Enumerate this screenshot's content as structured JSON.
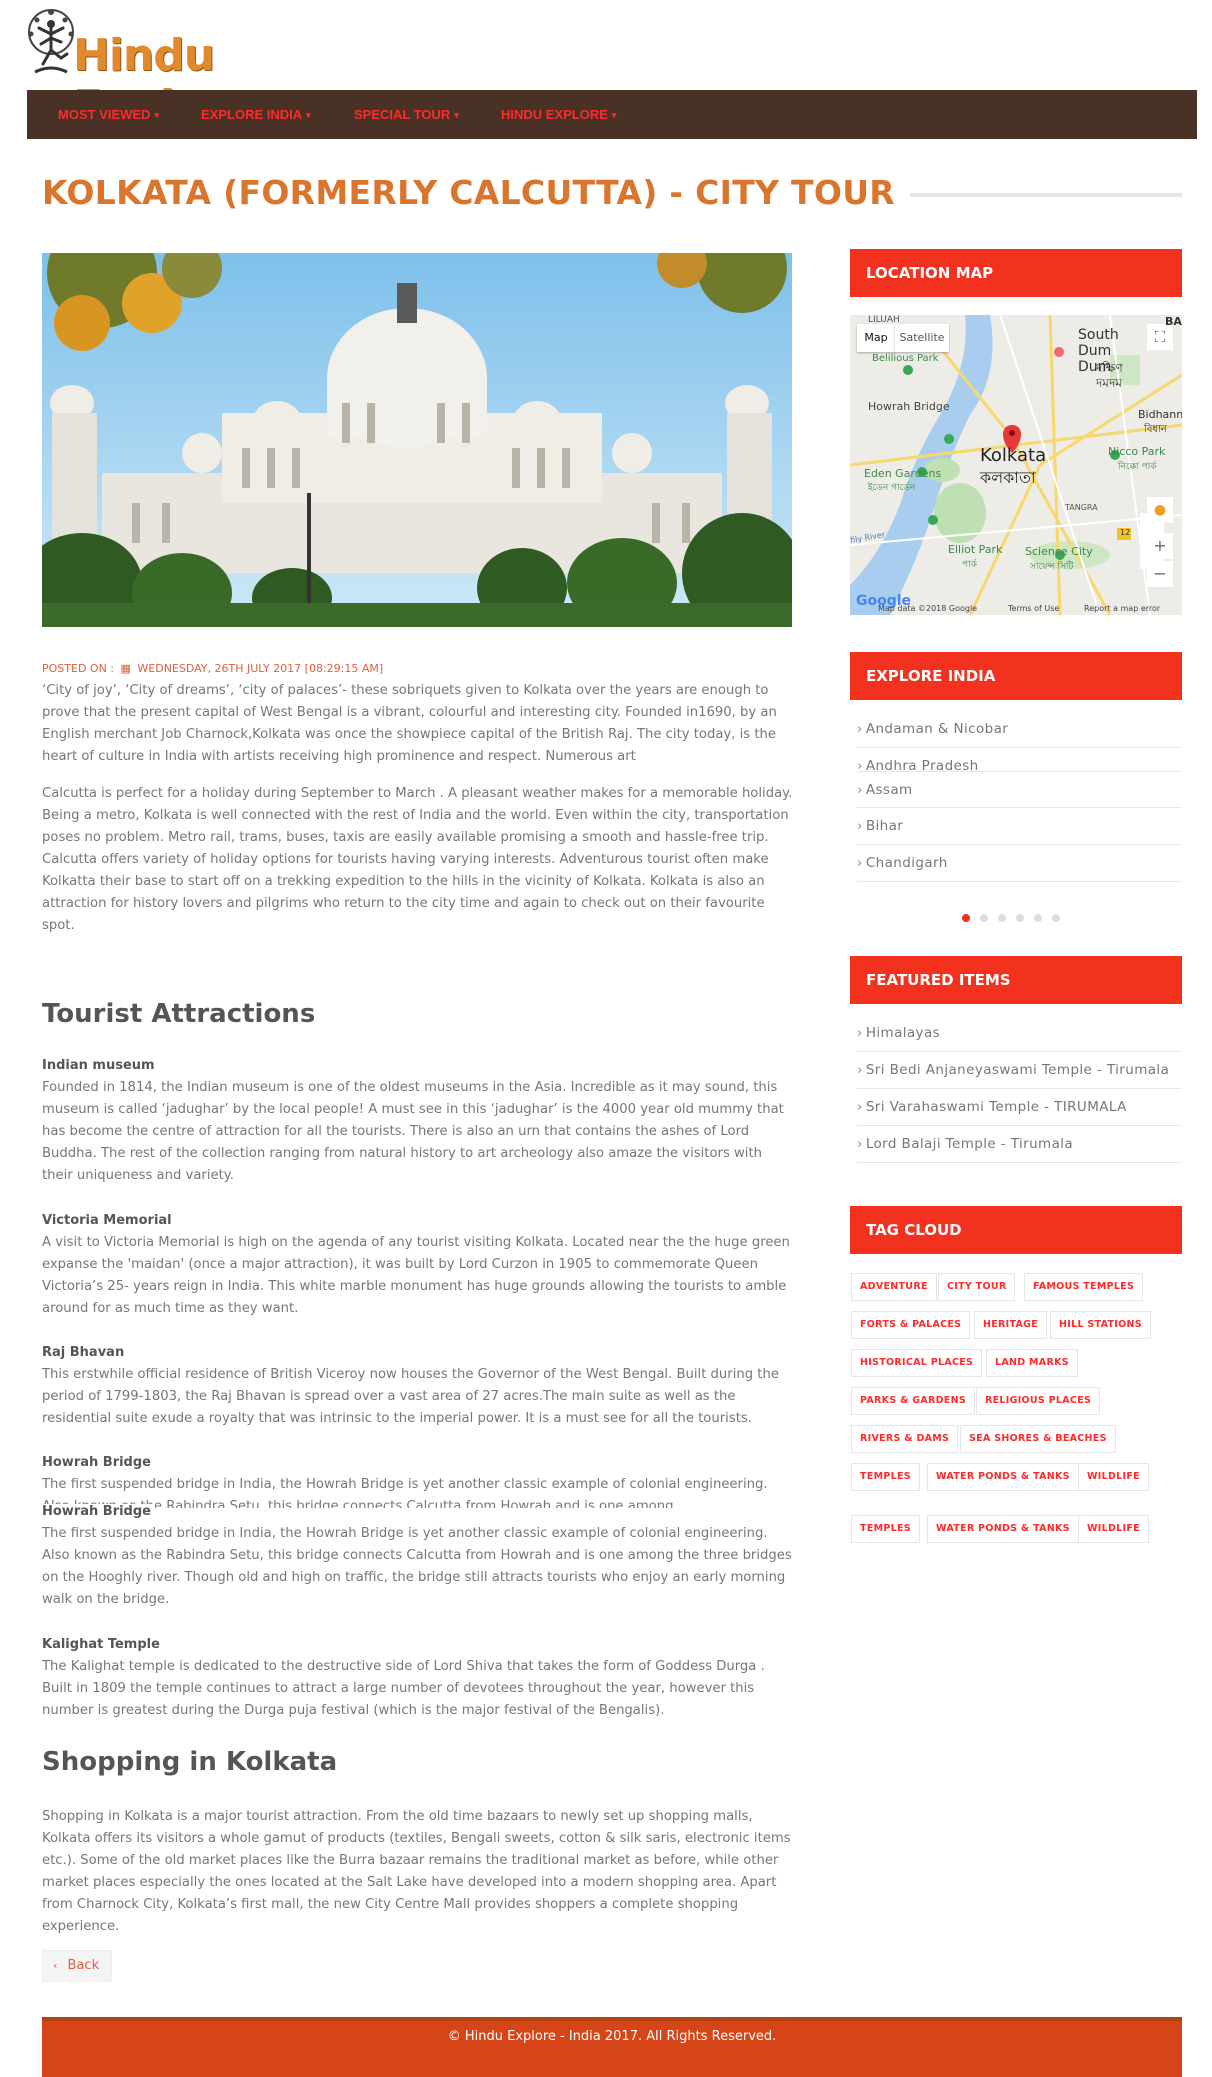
{
  "brand": {
    "name": "Hindu Explore"
  },
  "nav": {
    "items": [
      {
        "label": "MOST VIEWED"
      },
      {
        "label": "EXPLORE INDIA"
      },
      {
        "label": "SPECIAL TOUR"
      },
      {
        "label": "HINDU EXPLORE"
      }
    ]
  },
  "page": {
    "title": "KOLKATA (FORMERLY CALCUTTA) - CITY TOUR",
    "posted_on_label": "POSTED ON :",
    "posted_on_date": "WEDNESDAY, 26TH JULY 2017 [08:29:15 AM]",
    "intro_1": "‘City of joy’, ‘City of dreams’, ‘city of palaces’- these sobriquets given to Kolkata over the years are enough to prove that the present capital of West Bengal is a vibrant, colourful and interesting city. Founded in1690, by an English merchant Job Charnock,Kolkata was once the showpiece capital of the British Raj. The city today, is the heart of culture in India with artists receiving high prominence and respect. Numerous art",
    "intro_2": "Calcutta is perfect for a holiday during September to March . A pleasant weather makes for a memorable holiday. Being a metro, Kolkata is well connected with the rest of India and the world. Even within the city, transportation poses no problem. Metro rail, trams, buses, taxis are easily available promising a smooth and hassle-free trip. Calcutta offers variety of holiday options for tourists having varying interests. Adventurous tourist often make Kolkatta their base to start off on a trekking expedition to the hills in the vicinity of Kolkata. Kolkata is also an attraction for history lovers and pilgrims who return to the city time and again to check out on their favourite spot.",
    "attractions_heading": "Tourist Attractions",
    "attractions": [
      {
        "title": "Indian museum",
        "text": "Founded in 1814, the Indian museum is one of the oldest museums in the Asia. Incredible as it may sound, this museum is called ‘jadughar’ by the local people! A must see in this ‘jadughar’ is the 4000 year old mummy that has become the centre of attraction for all the tourists. There is also an urn that contains the ashes of Lord Buddha. The rest of the collection ranging from natural history to art archeology also amaze the visitors with their uniqueness and variety."
      },
      {
        "title": "Victoria Memorial",
        "text": "A visit to Victoria Memorial is high on the agenda of any tourist visiting Kolkata. Located near the the huge green expanse the 'maidan' (once a major attraction), it was built by Lord Curzon in 1905 to commemorate Queen Victoria’s 25- years reign in India. This white marble monument has huge grounds allowing the tourists to amble around for as much time as they want."
      },
      {
        "title": "Raj Bhavan",
        "text": "This erstwhile official residence of British Viceroy now houses the Governor of the West Bengal. Built during the period of 1799-1803, the Raj Bhavan is spread over a vast area of 27 acres.The main suite as well as the residential suite exude a royalty that was intrinsic to the imperial power. It is a must see for all the tourists."
      },
      {
        "title": "Howrah Bridge",
        "text": "The first suspended bridge in India, the Howrah Bridge is yet another classic example of colonial engineering. Also known as the Rabindra Setu, this bridge connects Calcutta from Howrah and is one among"
      },
      {
        "title": "Howrah Bridge",
        "text": "The first suspended bridge in India, the Howrah Bridge is yet another classic example of colonial engineering. Also known as the Rabindra Setu, this bridge connects Calcutta from Howrah and is one among the three bridges on the Hooghly river. Though old and high on traffic, the bridge still attracts tourists who enjoy an early morning walk on the bridge."
      },
      {
        "title": "Kalighat Temple",
        "text": "The Kalighat temple is dedicated to the destructive side of Lord Shiva that takes the form of Goddess Durga . Built in 1809 the temple continues to attract a large number of devotees throughout the year, however this number is greatest during the Durga puja festival (which is the major festival of the Bengalis)."
      }
    ],
    "shopping_heading": "Shopping in Kolkata",
    "shopping_text": "Shopping in Kolkata is a major tourist attraction. From the old time bazaars to newly set up shopping malls, Kolkata offers its visitors a whole gamut of products (textiles, Bengali sweets, cotton & silk saris, electronic items etc.). Some of the old market places like the Burra bazaar remains the traditional market as before, while other market places especially the ones located at the Salt Lake have developed into a modern shopping area. Apart from Charnock City, Kolkata’s first mall, the new City Centre Mall provides shoppers a complete shopping experience.",
    "back_label": "Back"
  },
  "sidebar": {
    "location_map": {
      "heading": "LOCATION MAP",
      "map_type_map": "Map",
      "map_type_satellite": "Satellite",
      "labels": {
        "kolkata": "Kolkata",
        "kolkata_bn": "কলকাতা",
        "howrah_bridge": "Howrah Bridge",
        "eden_gardens": "Eden Gardens",
        "eden_gardens_bn": "ইডেন গার্ডেন",
        "elliot_park": "Elliot Park",
        "elliot_park_bn": "পার্ক",
        "science_city": "Science City",
        "science_city_bn": "সায়েন্স সিটি",
        "nicco_park": "Nicco Park",
        "nicco_park_bn": "নিক্কো পার্ক",
        "south_dum_dum": "South Dum Dum",
        "south_dum_dum_bn_1": "দক্ষিণ",
        "south_dum_dum_bn_2": "দমদম",
        "bidhannagar": "Bidhann",
        "bidhannagar_bn": "বিধান",
        "belilious_park": "Belilious Park",
        "liluah": "LILUAH",
        "tangra": "TANGRA",
        "ba": "BA",
        "road_12": "12",
        "fily_river": "fily River",
        "map_data": "Map data ©2018 Google",
        "terms": "Terms of Use",
        "report": "Report a map error",
        "google": "Google"
      }
    },
    "explore_india": {
      "heading": "EXPLORE INDIA",
      "items": [
        "Andaman & Nicobar",
        "Andhra Pradesh",
        "Assam",
        "Bihar",
        "Chandigarh"
      ]
    },
    "featured_items": {
      "heading": "FEATURED ITEMS",
      "items": [
        "Himalayas",
        "Sri Bedi Anjaneyaswami Temple - Tirumala",
        "Sri Varahaswami Temple - TIRUMALA",
        "Lord Balaji Temple - Tirumala"
      ]
    },
    "tag_cloud": {
      "heading": "TAG CLOUD",
      "tags": [
        "ADVENTURE",
        "CITY TOUR",
        "FAMOUS TEMPLES",
        "FORTS & PALACES",
        "HERITAGE",
        "HILL STATIONS",
        "HISTORICAL PLACES",
        "LAND MARKS",
        "PARKS & GARDENS",
        "RELIGIOUS PLACES",
        "RIVERS & DAMS",
        "SEA SHORES & BEACHES",
        "TEMPLES",
        "WATER PONDS & TANKS",
        "WILDLIFE",
        "TEMPLES",
        "WATER PONDS & TANKS",
        "WILDLIFE"
      ]
    }
  },
  "footer": {
    "text": "© Hindu Explore - India 2017. All Rights Reserved."
  },
  "colors": {
    "brand_orange": "#e08a2c",
    "nav_bg": "#4a3125",
    "nav_text": "#ff2a2a",
    "title": "#d9752c",
    "side_head": "#f2311f",
    "footer": "#d64518"
  }
}
